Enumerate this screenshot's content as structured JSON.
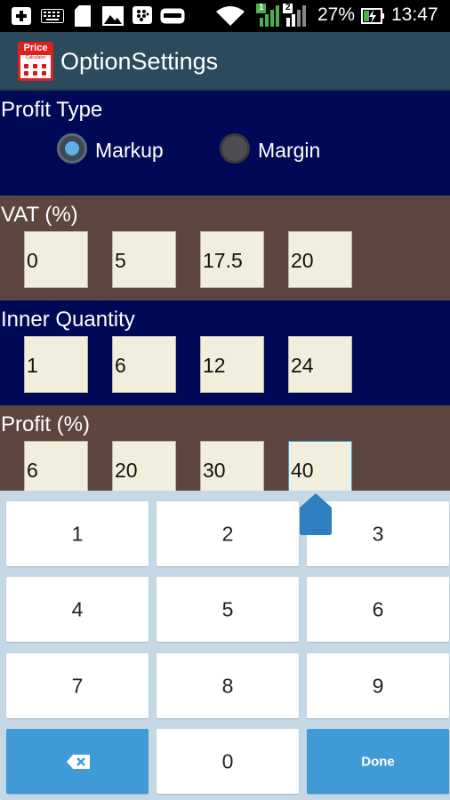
{
  "status_bar": {
    "battery": "27%",
    "time": "13:47",
    "sim1": "1",
    "sim2": "2"
  },
  "action_bar": {
    "app_icon_label": "Price",
    "app_icon_sub": "Calculator",
    "title": "OptionSettings"
  },
  "profit_type": {
    "label": "Profit Type",
    "options": [
      "Markup",
      "Margin"
    ],
    "selected": "Markup"
  },
  "vat": {
    "label": "VAT (%)",
    "values": [
      "0",
      "5",
      "17.5",
      "20"
    ]
  },
  "inner_quantity": {
    "label": "Inner Quantity",
    "values": [
      "1",
      "6",
      "12",
      "24"
    ]
  },
  "profit": {
    "label": "Profit (%)",
    "values": [
      "6",
      "20",
      "30",
      "40"
    ]
  },
  "keyboard": {
    "keys": [
      "1",
      "2",
      "3",
      "4",
      "5",
      "6",
      "7",
      "8",
      "9",
      "0"
    ],
    "done_label": "Done",
    "backspace_icon": "backspace-icon"
  },
  "colors": {
    "navy_section": "#000955",
    "brown_section": "#5e4640",
    "action_bar": "#2c4a5c",
    "accent_blue": "#3f9ad6",
    "field_bg": "#f1eedd"
  }
}
